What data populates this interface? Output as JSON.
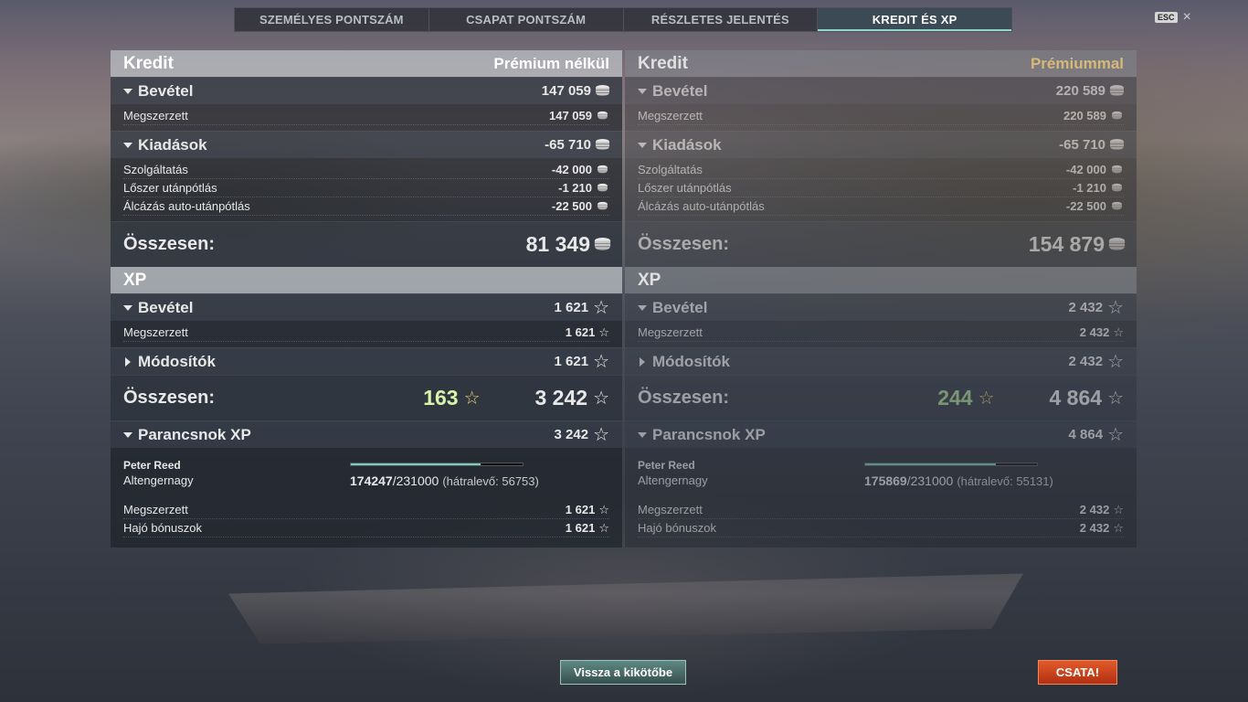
{
  "tabs": [
    {
      "label": "SZEMÉLYES PONTSZÁM"
    },
    {
      "label": "CSAPAT PONTSZÁM"
    },
    {
      "label": "RÉSZLETES JELENTÉS"
    },
    {
      "label": "KREDIT ÉS XP"
    }
  ],
  "esc": {
    "key": "ESC"
  },
  "left": {
    "credit_title": "Kredit",
    "premium_label": "Prémium nélkül",
    "income_label": "Bevétel",
    "income_value": "147 059",
    "earned_label": "Megszerzett",
    "earned_value": "147 059",
    "expenses_label": "Kiadások",
    "expenses_value": "-65 710",
    "service_label": "Szolgáltatás",
    "service_value": "-42 000",
    "ammo_label": "Lőszer utánpótlás",
    "ammo_value": "-1 210",
    "camo_label": "Álcázás auto-utánpótlás",
    "camo_value": "-22 500",
    "total_label": "Összesen:",
    "total_value": "81 349",
    "xp_title": "XP",
    "xp_income_label": "Bevétel",
    "xp_income_value": "1 621",
    "xp_earned_label": "Megszerzett",
    "xp_earned_value": "1 621",
    "modifiers_label": "Módosítók",
    "modifiers_value": "1 621",
    "xp_total_label": "Összesen:",
    "xp_free_value": "163",
    "xp_total_value": "3 242",
    "cmd_title": "Parancsnok XP",
    "cmd_value": "3 242",
    "cmd_name": "Peter Reed",
    "cmd_rank": "Altengernagy",
    "cmd_xp_current": "174247",
    "cmd_xp_max": "/231000",
    "cmd_xp_remaining": "(hátralevő: 56753)",
    "cmd_progress": 0.754,
    "cmd_earned_label": "Megszerzett",
    "cmd_earned_value": "1 621",
    "ship_bonus_label": "Hajó bónuszok",
    "ship_bonus_value": "1 621"
  },
  "right": {
    "credit_title": "Kredit",
    "premium_label": "Prémiummal",
    "income_label": "Bevétel",
    "income_value": "220 589",
    "earned_label": "Megszerzett",
    "earned_value": "220 589",
    "expenses_label": "Kiadások",
    "expenses_value": "-65 710",
    "service_label": "Szolgáltatás",
    "service_value": "-42 000",
    "ammo_label": "Lőszer utánpótlás",
    "ammo_value": "-1 210",
    "camo_label": "Álcázás auto-utánpótlás",
    "camo_value": "-22 500",
    "total_label": "Összesen:",
    "total_value": "154 879",
    "xp_title": "XP",
    "xp_income_label": "Bevétel",
    "xp_income_value": "2 432",
    "xp_earned_label": "Megszerzett",
    "xp_earned_value": "2 432",
    "modifiers_label": "Módosítók",
    "modifiers_value": "2 432",
    "xp_total_label": "Összesen:",
    "xp_free_value": "244",
    "xp_total_value": "4 864",
    "cmd_title": "Parancsnok XP",
    "cmd_value": "4 864",
    "cmd_name": "Peter Reed",
    "cmd_rank": "Altengernagy",
    "cmd_xp_current": "175869",
    "cmd_xp_max": "/231000",
    "cmd_xp_remaining": "(hátralevő: 55131)",
    "cmd_progress": 0.761,
    "cmd_earned_label": "Megszerzett",
    "cmd_earned_value": "2 432",
    "ship_bonus_label": "Hajó bónuszok",
    "ship_bonus_value": "2 432"
  },
  "buttons": {
    "back_to_port": "Vissza a kikötőbe",
    "battle": "CSATA!"
  },
  "icons": {
    "credit": "credit-coin-icon",
    "xp": "xp-star-icon"
  },
  "colors": {
    "active_tab": "#3c4e58",
    "battle_button": "#c8401c",
    "port_button": "#4a6e6a",
    "free_xp": "#d6f5a8",
    "premium_label": "#d6b879"
  }
}
